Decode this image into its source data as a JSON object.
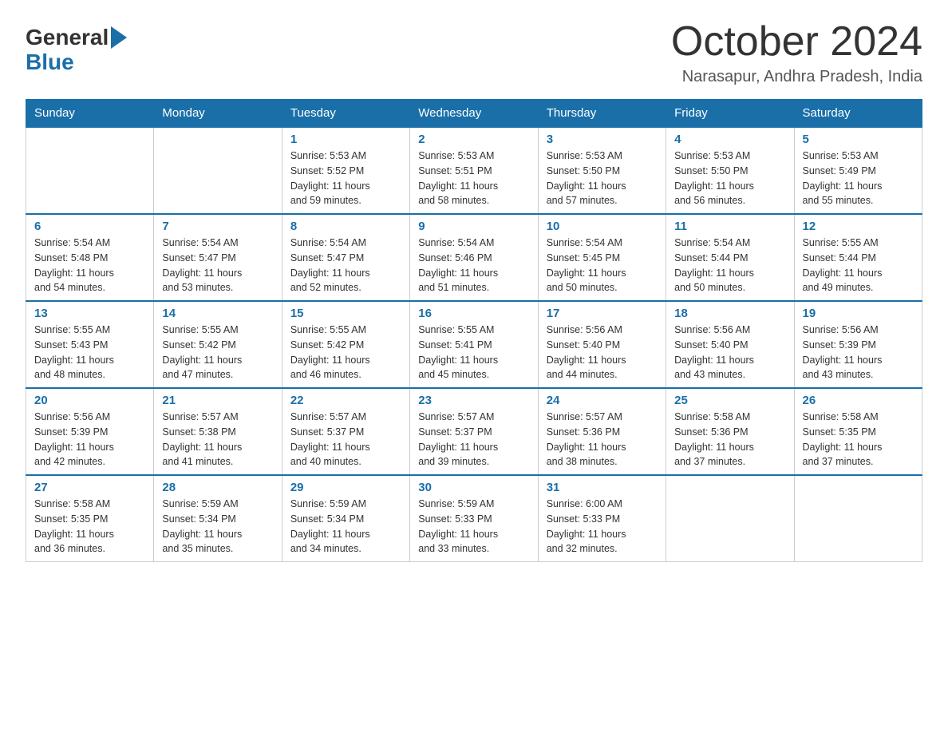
{
  "header": {
    "logo_general": "General",
    "logo_blue": "Blue",
    "month_year": "October 2024",
    "location": "Narasapur, Andhra Pradesh, India"
  },
  "weekdays": [
    "Sunday",
    "Monday",
    "Tuesday",
    "Wednesday",
    "Thursday",
    "Friday",
    "Saturday"
  ],
  "weeks": [
    [
      {
        "day": "",
        "info": ""
      },
      {
        "day": "",
        "info": ""
      },
      {
        "day": "1",
        "info": "Sunrise: 5:53 AM\nSunset: 5:52 PM\nDaylight: 11 hours\nand 59 minutes."
      },
      {
        "day": "2",
        "info": "Sunrise: 5:53 AM\nSunset: 5:51 PM\nDaylight: 11 hours\nand 58 minutes."
      },
      {
        "day": "3",
        "info": "Sunrise: 5:53 AM\nSunset: 5:50 PM\nDaylight: 11 hours\nand 57 minutes."
      },
      {
        "day": "4",
        "info": "Sunrise: 5:53 AM\nSunset: 5:50 PM\nDaylight: 11 hours\nand 56 minutes."
      },
      {
        "day": "5",
        "info": "Sunrise: 5:53 AM\nSunset: 5:49 PM\nDaylight: 11 hours\nand 55 minutes."
      }
    ],
    [
      {
        "day": "6",
        "info": "Sunrise: 5:54 AM\nSunset: 5:48 PM\nDaylight: 11 hours\nand 54 minutes."
      },
      {
        "day": "7",
        "info": "Sunrise: 5:54 AM\nSunset: 5:47 PM\nDaylight: 11 hours\nand 53 minutes."
      },
      {
        "day": "8",
        "info": "Sunrise: 5:54 AM\nSunset: 5:47 PM\nDaylight: 11 hours\nand 52 minutes."
      },
      {
        "day": "9",
        "info": "Sunrise: 5:54 AM\nSunset: 5:46 PM\nDaylight: 11 hours\nand 51 minutes."
      },
      {
        "day": "10",
        "info": "Sunrise: 5:54 AM\nSunset: 5:45 PM\nDaylight: 11 hours\nand 50 minutes."
      },
      {
        "day": "11",
        "info": "Sunrise: 5:54 AM\nSunset: 5:44 PM\nDaylight: 11 hours\nand 50 minutes."
      },
      {
        "day": "12",
        "info": "Sunrise: 5:55 AM\nSunset: 5:44 PM\nDaylight: 11 hours\nand 49 minutes."
      }
    ],
    [
      {
        "day": "13",
        "info": "Sunrise: 5:55 AM\nSunset: 5:43 PM\nDaylight: 11 hours\nand 48 minutes."
      },
      {
        "day": "14",
        "info": "Sunrise: 5:55 AM\nSunset: 5:42 PM\nDaylight: 11 hours\nand 47 minutes."
      },
      {
        "day": "15",
        "info": "Sunrise: 5:55 AM\nSunset: 5:42 PM\nDaylight: 11 hours\nand 46 minutes."
      },
      {
        "day": "16",
        "info": "Sunrise: 5:55 AM\nSunset: 5:41 PM\nDaylight: 11 hours\nand 45 minutes."
      },
      {
        "day": "17",
        "info": "Sunrise: 5:56 AM\nSunset: 5:40 PM\nDaylight: 11 hours\nand 44 minutes."
      },
      {
        "day": "18",
        "info": "Sunrise: 5:56 AM\nSunset: 5:40 PM\nDaylight: 11 hours\nand 43 minutes."
      },
      {
        "day": "19",
        "info": "Sunrise: 5:56 AM\nSunset: 5:39 PM\nDaylight: 11 hours\nand 43 minutes."
      }
    ],
    [
      {
        "day": "20",
        "info": "Sunrise: 5:56 AM\nSunset: 5:39 PM\nDaylight: 11 hours\nand 42 minutes."
      },
      {
        "day": "21",
        "info": "Sunrise: 5:57 AM\nSunset: 5:38 PM\nDaylight: 11 hours\nand 41 minutes."
      },
      {
        "day": "22",
        "info": "Sunrise: 5:57 AM\nSunset: 5:37 PM\nDaylight: 11 hours\nand 40 minutes."
      },
      {
        "day": "23",
        "info": "Sunrise: 5:57 AM\nSunset: 5:37 PM\nDaylight: 11 hours\nand 39 minutes."
      },
      {
        "day": "24",
        "info": "Sunrise: 5:57 AM\nSunset: 5:36 PM\nDaylight: 11 hours\nand 38 minutes."
      },
      {
        "day": "25",
        "info": "Sunrise: 5:58 AM\nSunset: 5:36 PM\nDaylight: 11 hours\nand 37 minutes."
      },
      {
        "day": "26",
        "info": "Sunrise: 5:58 AM\nSunset: 5:35 PM\nDaylight: 11 hours\nand 37 minutes."
      }
    ],
    [
      {
        "day": "27",
        "info": "Sunrise: 5:58 AM\nSunset: 5:35 PM\nDaylight: 11 hours\nand 36 minutes."
      },
      {
        "day": "28",
        "info": "Sunrise: 5:59 AM\nSunset: 5:34 PM\nDaylight: 11 hours\nand 35 minutes."
      },
      {
        "day": "29",
        "info": "Sunrise: 5:59 AM\nSunset: 5:34 PM\nDaylight: 11 hours\nand 34 minutes."
      },
      {
        "day": "30",
        "info": "Sunrise: 5:59 AM\nSunset: 5:33 PM\nDaylight: 11 hours\nand 33 minutes."
      },
      {
        "day": "31",
        "info": "Sunrise: 6:00 AM\nSunset: 5:33 PM\nDaylight: 11 hours\nand 32 minutes."
      },
      {
        "day": "",
        "info": ""
      },
      {
        "day": "",
        "info": ""
      }
    ]
  ]
}
